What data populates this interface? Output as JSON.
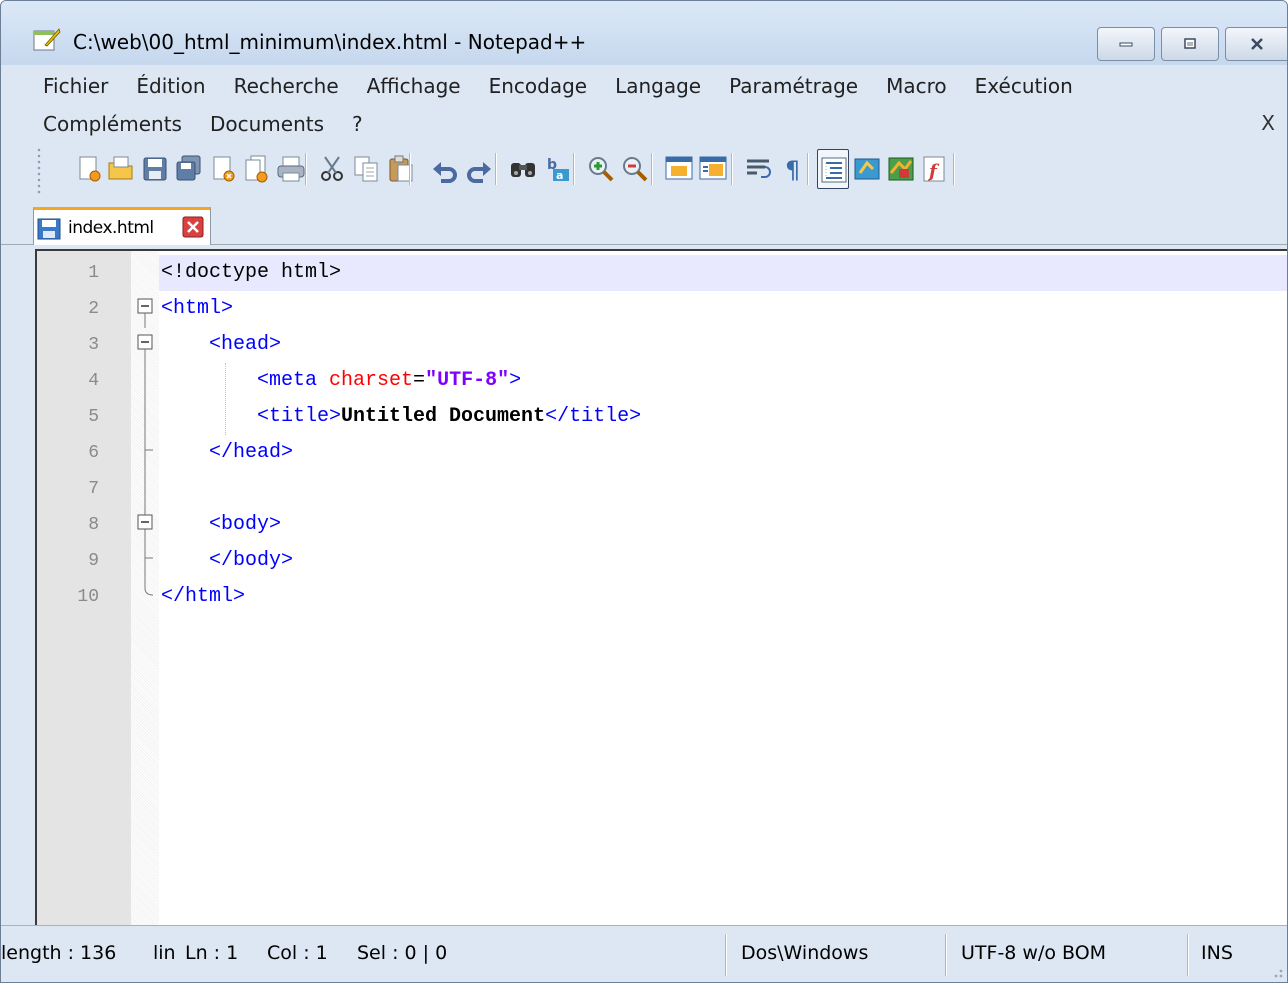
{
  "window": {
    "title": "C:\\web\\00_html_minimum\\index.html - Notepad++"
  },
  "menu": {
    "row1": [
      "Fichier",
      "Édition",
      "Recherche",
      "Affichage",
      "Encodage",
      "Langage",
      "Paramétrage",
      "Macro",
      "Exécution"
    ],
    "row2": [
      "Compléments",
      "Documents",
      "?"
    ],
    "close_label": "X"
  },
  "toolbar_icons": [
    "new-file-icon",
    "open-file-icon",
    "save-icon",
    "save-all-icon",
    "close-icon",
    "close-all-icon",
    "print-icon",
    "cut-icon",
    "copy-icon",
    "paste-icon",
    "undo-icon",
    "redo-icon",
    "find-icon",
    "replace-icon",
    "zoom-in-icon",
    "zoom-out-icon",
    "sync-vertical-icon",
    "sync-horizontal-icon",
    "word-wrap-icon",
    "show-all-chars-icon",
    "indent-guide-icon",
    "user-lang-icon",
    "doc-map-icon",
    "function-list-icon"
  ],
  "tab": {
    "label": "index.html"
  },
  "editor": {
    "lines": [
      {
        "n": "1",
        "tokens": [
          {
            "t": "<!doctype html>",
            "c": "t-doctype"
          }
        ]
      },
      {
        "n": "2",
        "tokens": [
          {
            "t": "<html>",
            "c": "t-tag"
          }
        ]
      },
      {
        "n": "3",
        "tokens": [
          {
            "t": "    ",
            "c": ""
          },
          {
            "t": "<head>",
            "c": "t-tag"
          }
        ]
      },
      {
        "n": "4",
        "tokens": [
          {
            "t": "        ",
            "c": ""
          },
          {
            "t": "<meta ",
            "c": "t-tag"
          },
          {
            "t": "charset",
            "c": "t-attr"
          },
          {
            "t": "=",
            "c": "t-doctype"
          },
          {
            "t": "\"UTF-8\"",
            "c": "t-val"
          },
          {
            "t": ">",
            "c": "t-tag"
          }
        ]
      },
      {
        "n": "5",
        "tokens": [
          {
            "t": "        ",
            "c": ""
          },
          {
            "t": "<title>",
            "c": "t-tag"
          },
          {
            "t": "Untitled Document",
            "c": "t-text"
          },
          {
            "t": "</title>",
            "c": "t-tag"
          }
        ]
      },
      {
        "n": "6",
        "tokens": [
          {
            "t": "    ",
            "c": ""
          },
          {
            "t": "</head>",
            "c": "t-tag"
          }
        ]
      },
      {
        "n": "7",
        "tokens": []
      },
      {
        "n": "8",
        "tokens": [
          {
            "t": "    ",
            "c": ""
          },
          {
            "t": "<body>",
            "c": "t-tag"
          }
        ]
      },
      {
        "n": "9",
        "tokens": [
          {
            "t": "    ",
            "c": ""
          },
          {
            "t": "</body>",
            "c": "t-tag"
          }
        ]
      },
      {
        "n": "10",
        "tokens": [
          {
            "t": "</html>",
            "c": "t-tag"
          }
        ]
      }
    ]
  },
  "status": {
    "length": "length : 136",
    "lines": "lin",
    "ln": "Ln : 1",
    "col": "Col : 1",
    "sel": "Sel : 0 | 0",
    "eol": "Dos\\Windows",
    "encoding": "UTF-8 w/o BOM",
    "mode": "INS"
  }
}
